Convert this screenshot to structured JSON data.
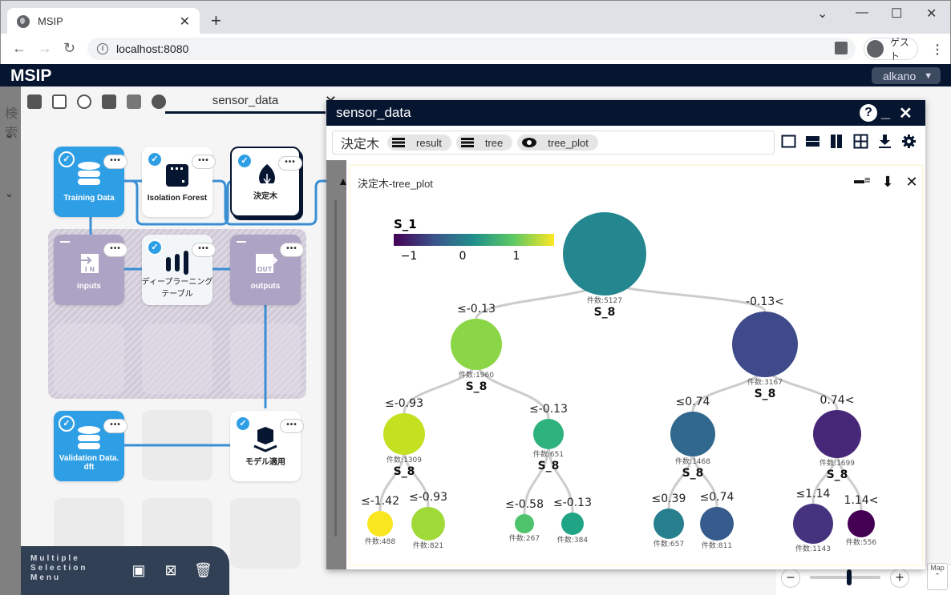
{
  "browser": {
    "tab_title": "MSIP",
    "url": "localhost:8080",
    "profile": "ゲスト",
    "icons": [
      "globe-icon",
      "close-icon",
      "plus-icon",
      "chevron-down-icon",
      "minimize-icon",
      "maximize-icon",
      "close-icon",
      "back-icon",
      "forward-icon",
      "reload-icon",
      "info-icon",
      "translate-icon",
      "avatar-icon",
      "kebab-menu-icon"
    ]
  },
  "app": {
    "brand": "MSIP",
    "user": "alkano"
  },
  "left_panel": {
    "search_label": "検索"
  },
  "workspace": {
    "tab_label": "sensor_data",
    "toolbar": [
      "save-icon",
      "save-as-icon",
      "run-icon",
      "chart-icon",
      "copy-icon",
      "help-icon"
    ],
    "nodes": [
      {
        "label": "Training Data",
        "type": "data",
        "checked": true
      },
      {
        "label": "Isolation Forest",
        "type": "model",
        "checked": true
      },
      {
        "label": "決定木",
        "type": "model",
        "checked": true,
        "selected": true
      },
      {
        "label": "inputs",
        "type": "group-input"
      },
      {
        "label": "ディープラーニング\nテーブル",
        "type": "model",
        "checked": true
      },
      {
        "label": "outputs",
        "type": "group-output"
      },
      {
        "label": "Validation Data.dft",
        "type": "data",
        "checked": true
      },
      {
        "label": "モデル適用",
        "type": "apply",
        "checked": true
      }
    ],
    "multi_menu": {
      "label": "Multiple Selection Menu"
    },
    "zoom": {
      "minus": "−",
      "plus": "+",
      "map_label": "Map",
      "level": 0.5
    }
  },
  "modal": {
    "title": "sensor_data",
    "breadcrumb": {
      "root": "決定木",
      "chips": [
        {
          "label": "result",
          "icon": "list-icon"
        },
        {
          "label": "tree",
          "icon": "list-icon"
        },
        {
          "label": "tree_plot",
          "icon": "eye-icon"
        }
      ]
    },
    "plot_title": "決定木-tree_plot"
  },
  "chart_data": {
    "type": "tree",
    "color_scale": {
      "title": "S_1",
      "ticks": [
        "−1",
        "0",
        "1"
      ],
      "range": [
        -1.3,
        1.8
      ],
      "colormap": "viridis"
    },
    "nodes": [
      {
        "id": "n0",
        "count": "件数:5127",
        "split": "S_8",
        "edge": "",
        "color": "#24868e",
        "parent": null
      },
      {
        "id": "n1",
        "count": "件数:1960",
        "split": "S_8",
        "edge": "≤-0.13",
        "color": "#8bd646",
        "parent": "n0"
      },
      {
        "id": "n2",
        "count": "件数:3167",
        "split": "S_8",
        "edge": "-0.13<",
        "color": "#3e4a89",
        "parent": "n0"
      },
      {
        "id": "n3",
        "count": "件数:1309",
        "split": "S_8",
        "edge": "≤-0.93",
        "color": "#c3e021",
        "parent": "n1"
      },
      {
        "id": "n4",
        "count": "件数:651",
        "split": "S_8",
        "edge": "≤-0.13",
        "color": "#2db27d",
        "parent": "n1"
      },
      {
        "id": "n5",
        "count": "件数:1468",
        "split": "S_8",
        "edge": "≤0.74",
        "color": "#31688e",
        "parent": "n2"
      },
      {
        "id": "n6",
        "count": "件数:1699",
        "split": "S_8",
        "edge": "0.74<",
        "color": "#472878",
        "parent": "n2"
      },
      {
        "id": "n7",
        "count": "件数:488",
        "split": "",
        "edge": "≤-1.42",
        "color": "#f8e621",
        "parent": "n3"
      },
      {
        "id": "n8",
        "count": "件数:821",
        "split": "",
        "edge": "≤-0.93",
        "color": "#a0da39",
        "parent": "n3"
      },
      {
        "id": "n9",
        "count": "件数:267",
        "split": "",
        "edge": "≤-0.58",
        "color": "#4ec36b",
        "parent": "n4"
      },
      {
        "id": "n10",
        "count": "件数:384",
        "split": "",
        "edge": "≤-0.13",
        "color": "#20a486",
        "parent": "n4"
      },
      {
        "id": "n11",
        "count": "件数:657",
        "split": "",
        "edge": "≤0.39",
        "color": "#277f8e",
        "parent": "n5"
      },
      {
        "id": "n12",
        "count": "件数:811",
        "split": "",
        "edge": "≤0.74",
        "color": "#365c8d",
        "parent": "n5"
      },
      {
        "id": "n13",
        "count": "件数:1143",
        "split": "",
        "edge": "≤1.14",
        "color": "#46337f",
        "parent": "n6"
      },
      {
        "id": "n14",
        "count": "件数:556",
        "split": "",
        "edge": "1.14<",
        "color": "#440154",
        "parent": "n6"
      }
    ]
  }
}
